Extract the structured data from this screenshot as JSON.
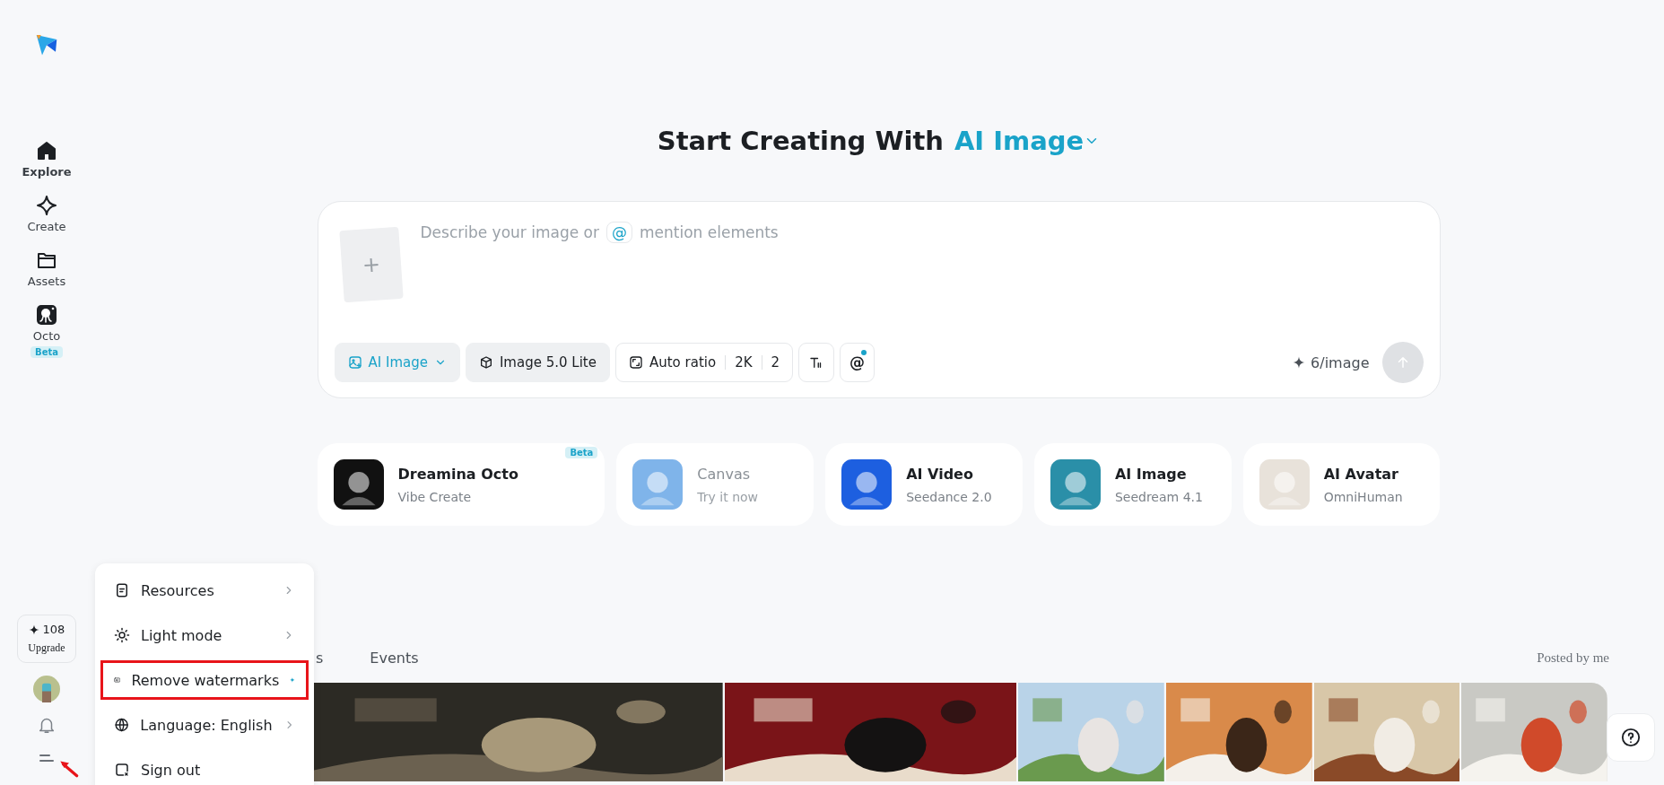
{
  "sidebar": {
    "nav": [
      {
        "label": "Explore",
        "selected": true
      },
      {
        "label": "Create",
        "selected": false
      },
      {
        "label": "Assets",
        "selected": false
      },
      {
        "label": "Octo",
        "selected": false,
        "badge": "Beta"
      }
    ],
    "credits": {
      "amount": "108",
      "action": "Upgrade"
    },
    "menu_button": {
      "pointed": true
    }
  },
  "heading": {
    "text": "Start Creating With",
    "mode": "AI Image"
  },
  "prompt": {
    "placeholder_start": "Describe your image or",
    "mention_symbol": "@",
    "placeholder_end": "mention elements",
    "upload_symbol": "+",
    "tools": [
      {
        "kind": "mode",
        "label": "AI Image"
      },
      {
        "kind": "model",
        "label": "Image 5.0 Lite"
      },
      {
        "kind": "ratio",
        "label": "Auto ratio",
        "values": [
          "2K",
          "2"
        ]
      },
      {
        "kind": "text-icon"
      },
      {
        "kind": "mention",
        "label": "@"
      }
    ],
    "cost": "6/image"
  },
  "cards": [
    {
      "title": "Dreamina Octo",
      "subtitle": "Vibe Create",
      "badge": "Beta",
      "disabled": false
    },
    {
      "title": "Canvas",
      "subtitle": "Try it now",
      "disabled": true
    },
    {
      "title": "AI Video",
      "subtitle": "Seedance 2.0",
      "disabled": false
    },
    {
      "title": "AI Image",
      "subtitle": "Seedream 4.1",
      "disabled": false
    },
    {
      "title": "AI Avatar",
      "subtitle": "OmniHuman",
      "disabled": false
    }
  ],
  "tabs": [
    {
      "label": "s"
    },
    {
      "label": "Events"
    }
  ],
  "posted_by_me": "Posted by me",
  "menu": [
    {
      "label": "Resources",
      "submenu": true,
      "highlighted": false,
      "new": false
    },
    {
      "label": "Light mode",
      "submenu": true,
      "highlighted": false,
      "new": false
    },
    {
      "label": "Remove watermarks",
      "submenu": false,
      "highlighted": true,
      "new": true
    },
    {
      "label": "Language: English",
      "submenu": true,
      "highlighted": false,
      "new": false
    },
    {
      "label": "Sign out",
      "submenu": false,
      "highlighted": false,
      "new": false
    }
  ]
}
